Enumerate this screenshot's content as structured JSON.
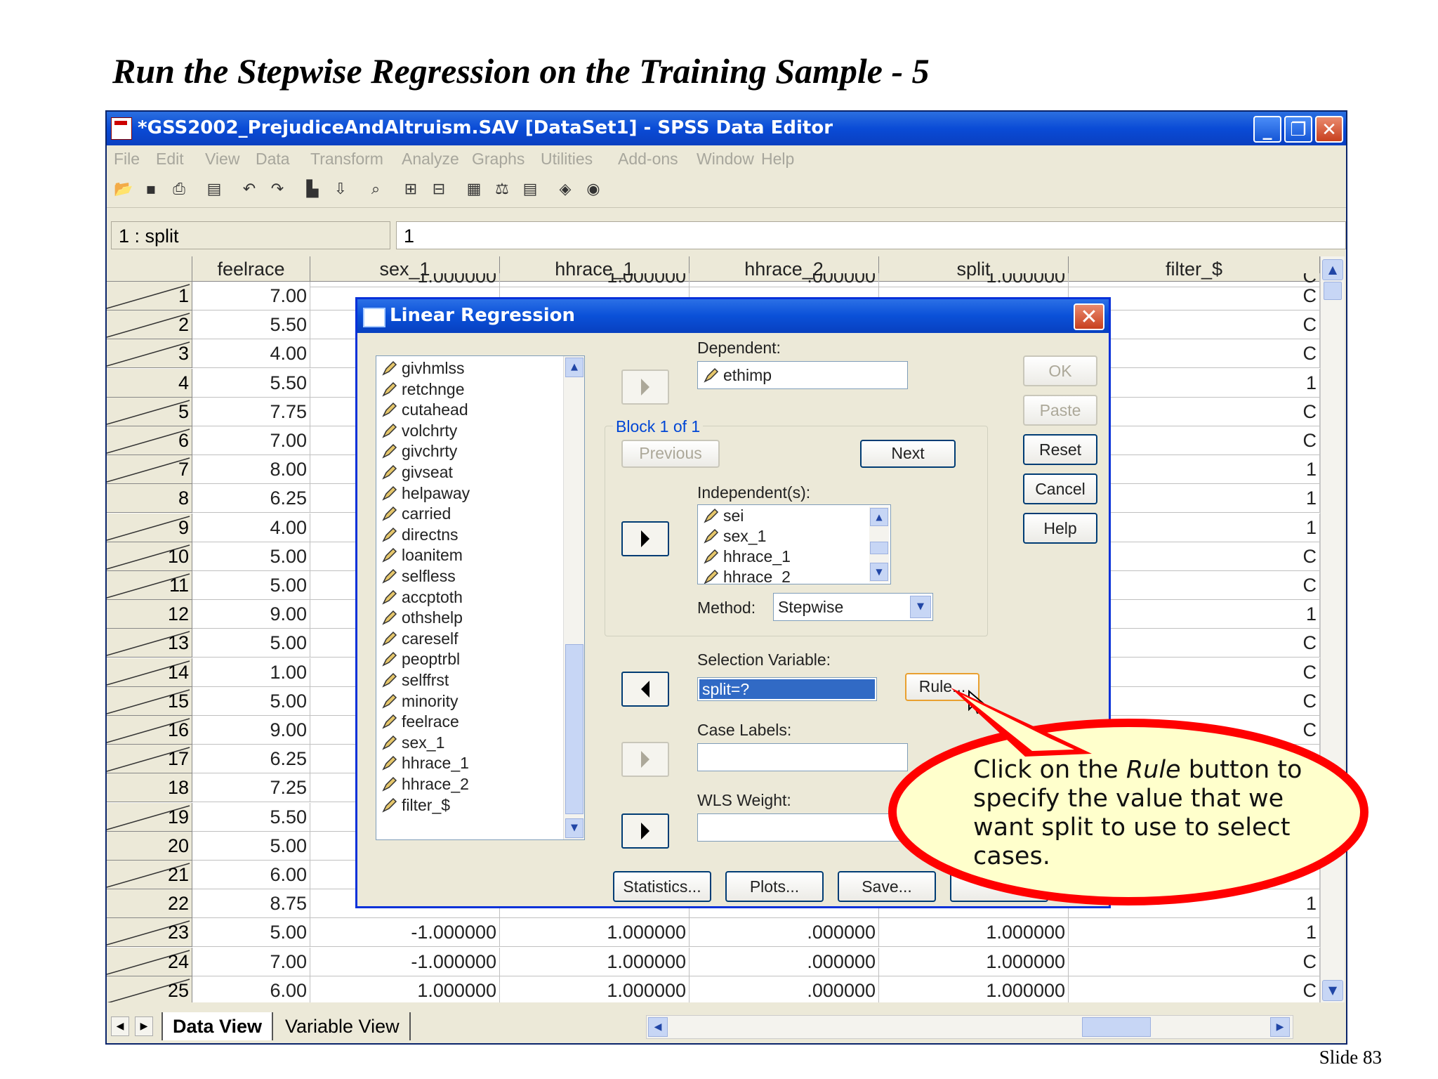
{
  "slide": {
    "title": "Run the Stepwise Regression on the Training Sample  - 5",
    "number": "Slide 83"
  },
  "window": {
    "title": "*GSS2002_PrejudiceAndAltruism.SAV [DataSet1] - SPSS Data Editor",
    "controls": [
      "minimize-icon",
      "restore-icon",
      "close-icon"
    ]
  },
  "menu": [
    "File",
    "Edit",
    "View",
    "Data",
    "Transform",
    "Analyze",
    "Graphs",
    "Utilities",
    "Add-ons",
    "Window",
    "Help"
  ],
  "cell_ref": "1 : split",
  "cell_value": "1",
  "grid": {
    "columns": [
      "feelrace",
      "sex_1",
      "hhrace_1",
      "hhrace_2",
      "split",
      "filter_$"
    ],
    "header_row_partial": [
      "",
      "1.000000",
      "1.000000",
      ".000000",
      "1.000000",
      "C"
    ],
    "rows": [
      {
        "n": "1",
        "feelrace": "7.00",
        "filter": "C"
      },
      {
        "n": "2",
        "feelrace": "5.50",
        "filter": "C"
      },
      {
        "n": "3",
        "feelrace": "4.00",
        "filter": "C"
      },
      {
        "n": "4",
        "feelrace": "5.50",
        "filter": "1"
      },
      {
        "n": "5",
        "feelrace": "7.75",
        "filter": "C"
      },
      {
        "n": "6",
        "feelrace": "7.00",
        "filter": "C"
      },
      {
        "n": "7",
        "feelrace": "8.00",
        "filter": "1"
      },
      {
        "n": "8",
        "feelrace": "6.25",
        "filter": "1"
      },
      {
        "n": "9",
        "feelrace": "4.00",
        "filter": "1"
      },
      {
        "n": "10",
        "feelrace": "5.00",
        "filter": "C"
      },
      {
        "n": "11",
        "feelrace": "5.00",
        "filter": "C"
      },
      {
        "n": "12",
        "feelrace": "9.00",
        "filter": "1"
      },
      {
        "n": "13",
        "feelrace": "5.00",
        "filter": "C"
      },
      {
        "n": "14",
        "feelrace": "1.00",
        "filter": "C"
      },
      {
        "n": "15",
        "feelrace": "5.00",
        "filter": "C"
      },
      {
        "n": "16",
        "feelrace": "9.00",
        "filter": "C"
      },
      {
        "n": "17",
        "feelrace": "6.25",
        "filter": ""
      },
      {
        "n": "18",
        "feelrace": "7.25",
        "filter": ""
      },
      {
        "n": "19",
        "feelrace": "5.50",
        "filter": ""
      },
      {
        "n": "20",
        "feelrace": "5.00",
        "filter": ""
      },
      {
        "n": "21",
        "feelrace": "6.00",
        "filter": ""
      },
      {
        "n": "22",
        "feelrace": "8.75",
        "filter": "1"
      },
      {
        "n": "23",
        "feelrace": "5.00",
        "sex_1": "-1.000000",
        "hhrace_1": "1.000000",
        "hhrace_2": ".000000",
        "split": "1.000000",
        "filter": "1"
      },
      {
        "n": "24",
        "feelrace": "7.00",
        "sex_1": "-1.000000",
        "hhrace_1": "1.000000",
        "hhrace_2": ".000000",
        "split": "1.000000",
        "filter": "C"
      },
      {
        "n": "25",
        "feelrace": "6.00",
        "sex_1": "1.000000",
        "hhrace_1": "1.000000",
        "hhrace_2": ".000000",
        "split": "1.000000",
        "filter": "C"
      }
    ]
  },
  "tabs": {
    "data_view": "Data View",
    "variable_view": "Variable View"
  },
  "dialog": {
    "title": "Linear Regression",
    "variables": [
      "givhmlss",
      "retchnge",
      "cutahead",
      "volchrty",
      "givchrty",
      "givseat",
      "helpaway",
      "carried",
      "directns",
      "loanitem",
      "selfless",
      "accptoth",
      "othshelp",
      "careself",
      "peoptrbl",
      "selffrst",
      "minority",
      "feelrace",
      "sex_1",
      "hhrace_1",
      "hhrace_2",
      "filter_$"
    ],
    "dependent_label": "Dependent:",
    "dependent_value": "ethimp",
    "block_label": "Block 1 of 1",
    "previous": "Previous",
    "next": "Next",
    "independents_label": "Independent(s):",
    "independents": [
      "sei",
      "sex_1",
      "hhrace_1",
      "hhrace_2"
    ],
    "method_label": "Method:",
    "method_value": "Stepwise",
    "selection_label": "Selection Variable:",
    "selection_value": "split=?",
    "rule": "Rule...",
    "case_labels": "Case Labels:",
    "wls_weight": "WLS Weight:",
    "buttons": {
      "ok": "OK",
      "paste": "Paste",
      "reset": "Reset",
      "cancel": "Cancel",
      "help": "Help"
    },
    "bottom_buttons": {
      "statistics": "Statistics...",
      "plots": "Plots...",
      "save": "Save..."
    }
  },
  "callout": {
    "before": "Click on the ",
    "emphasis": "Rule",
    "after": " button to specify the value that we want split to use to select cases."
  },
  "colors": {
    "title_blue": "#0a4bd6",
    "callout_fill": "#ffffcc",
    "callout_border": "#ff0000",
    "selection": "#316ac5"
  }
}
